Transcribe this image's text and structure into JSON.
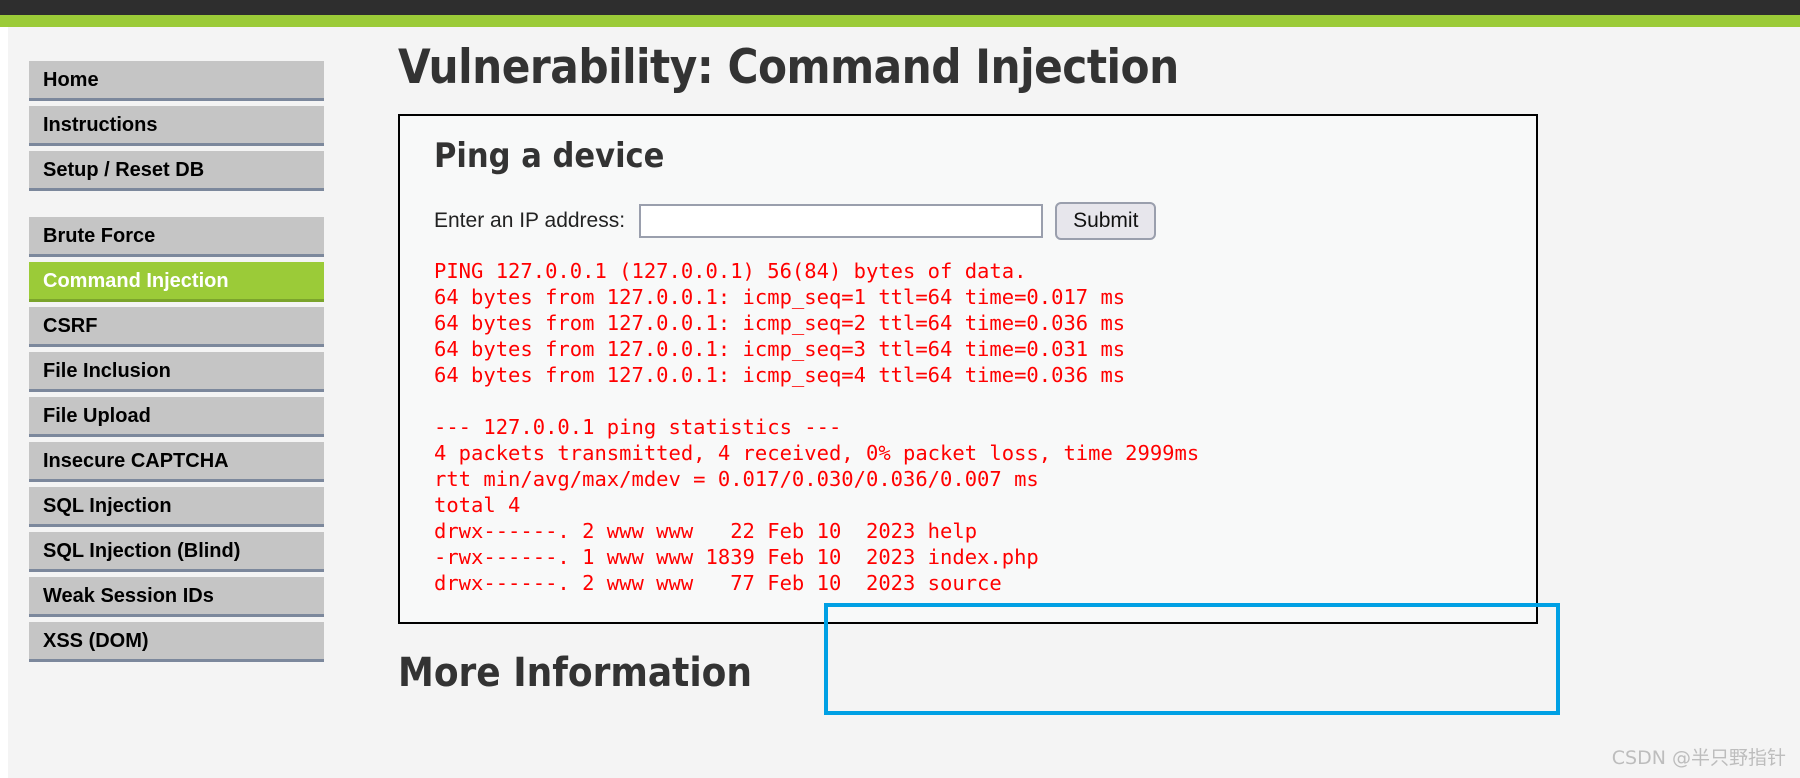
{
  "theme": {
    "topbar_color": "#2e2e2e",
    "accent_green": "#9bcb38",
    "nav_button_color": "#c5c5c5",
    "page_background": "#f4f4f4",
    "panel_background": "#f8f9f9",
    "terminal_text_color": "#ff0000",
    "annotation_box_color": "#00a0e4"
  },
  "sidebar": {
    "items": [
      {
        "label": "Home",
        "selected": false
      },
      {
        "label": "Instructions",
        "selected": false
      },
      {
        "label": "Setup / Reset DB",
        "selected": false
      },
      {
        "label": "Brute Force",
        "selected": false
      },
      {
        "label": "Command Injection",
        "selected": true
      },
      {
        "label": "CSRF",
        "selected": false
      },
      {
        "label": "File Inclusion",
        "selected": false
      },
      {
        "label": "File Upload",
        "selected": false
      },
      {
        "label": "Insecure CAPTCHA",
        "selected": false
      },
      {
        "label": "SQL Injection",
        "selected": false
      },
      {
        "label": "SQL Injection (Blind)",
        "selected": false
      },
      {
        "label": "Weak Session IDs",
        "selected": false
      },
      {
        "label": "XSS (DOM)",
        "selected": false
      }
    ]
  },
  "main": {
    "page_title": "Vulnerability: Command Injection",
    "panel_heading": "Ping a device",
    "form": {
      "ip_label": "Enter an IP address:",
      "ip_value": "",
      "ip_placeholder": "",
      "submit_label": "Submit"
    },
    "terminal": {
      "lines": [
        "PING 127.0.0.1 (127.0.0.1) 56(84) bytes of data.",
        "64 bytes from 127.0.0.1: icmp_seq=1 ttl=64 time=0.017 ms",
        "64 bytes from 127.0.0.1: icmp_seq=2 ttl=64 time=0.036 ms",
        "64 bytes from 127.0.0.1: icmp_seq=3 ttl=64 time=0.031 ms",
        "64 bytes from 127.0.0.1: icmp_seq=4 ttl=64 time=0.036 ms",
        "",
        "--- 127.0.0.1 ping statistics ---",
        "4 packets transmitted, 4 received, 0% packet loss, time 2999ms",
        "rtt min/avg/max/mdev = 0.017/0.030/0.036/0.007 ms",
        "total 4",
        "drwx------. 2 www www   22 Feb 10  2023 help",
        "-rwx------. 1 www www 1839 Feb 10  2023 index.php",
        "drwx------. 2 www www   77 Feb 10  2023 source"
      ]
    },
    "more_information_heading": "More Information"
  },
  "watermark": {
    "text": "CSDN @半只野指针"
  }
}
